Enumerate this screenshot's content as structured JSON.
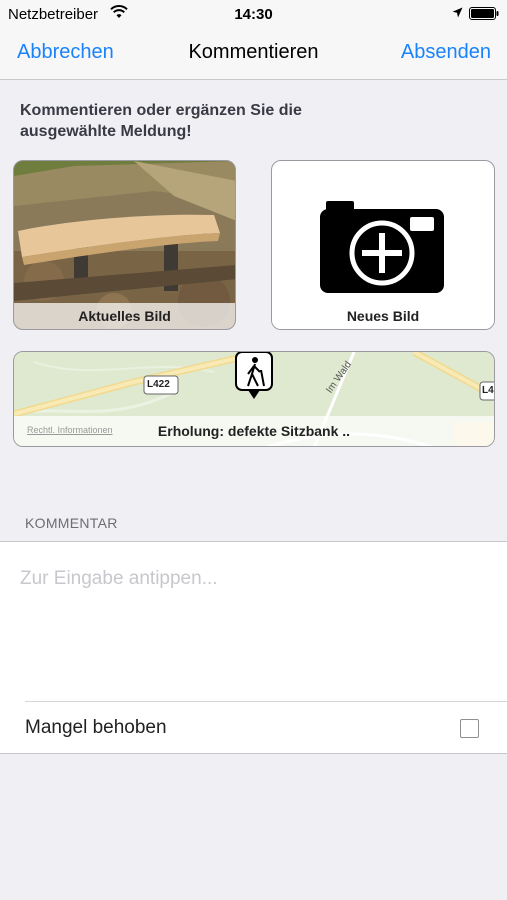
{
  "status_bar": {
    "carrier": "Netzbetreiber",
    "time": "14:30"
  },
  "nav": {
    "cancel_label": "Abbrechen",
    "title": "Kommentieren",
    "send_label": "Absenden"
  },
  "intro_text": "Kommentieren oder ergänzen Sie die ausgewählte Meldung!",
  "tiles": {
    "current_image_label": "Aktuelles Bild",
    "new_image_label": "Neues Bild"
  },
  "map": {
    "road_label": "L422",
    "road_label_right": "L4",
    "street_label": "Im Wald",
    "legal_link": "Rechtl. Informationen",
    "report_title": "Erholung: defekte Sitzbank .."
  },
  "comment": {
    "section_header": "KOMMENTAR",
    "placeholder": "Zur Eingabe antippen...",
    "value": ""
  },
  "defect_fixed": {
    "label": "Mangel behoben",
    "checked": false
  },
  "colors": {
    "accent": "#1a82fb",
    "background": "#efeff4"
  }
}
